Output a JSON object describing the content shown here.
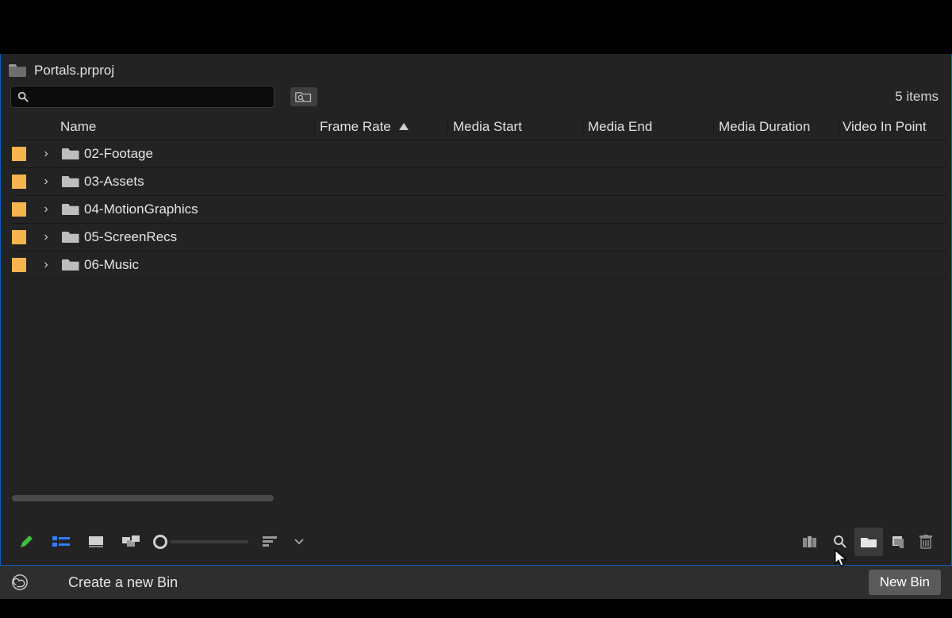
{
  "project": {
    "name": "Portals.prproj"
  },
  "search": {
    "placeholder": ""
  },
  "itemsCount": "5 items",
  "columns": {
    "name": "Name",
    "frameRate": "Frame Rate",
    "mediaStart": "Media Start",
    "mediaEnd": "Media End",
    "mediaDuration": "Media Duration",
    "videoInPoint": "Video In Point"
  },
  "bins": [
    {
      "name": "02-Footage"
    },
    {
      "name": "03-Assets"
    },
    {
      "name": "04-MotionGraphics"
    },
    {
      "name": "05-ScreenRecs"
    },
    {
      "name": "06-Music"
    }
  ],
  "tutorial": {
    "hint": "Create a new Bin",
    "button": "New Bin"
  }
}
